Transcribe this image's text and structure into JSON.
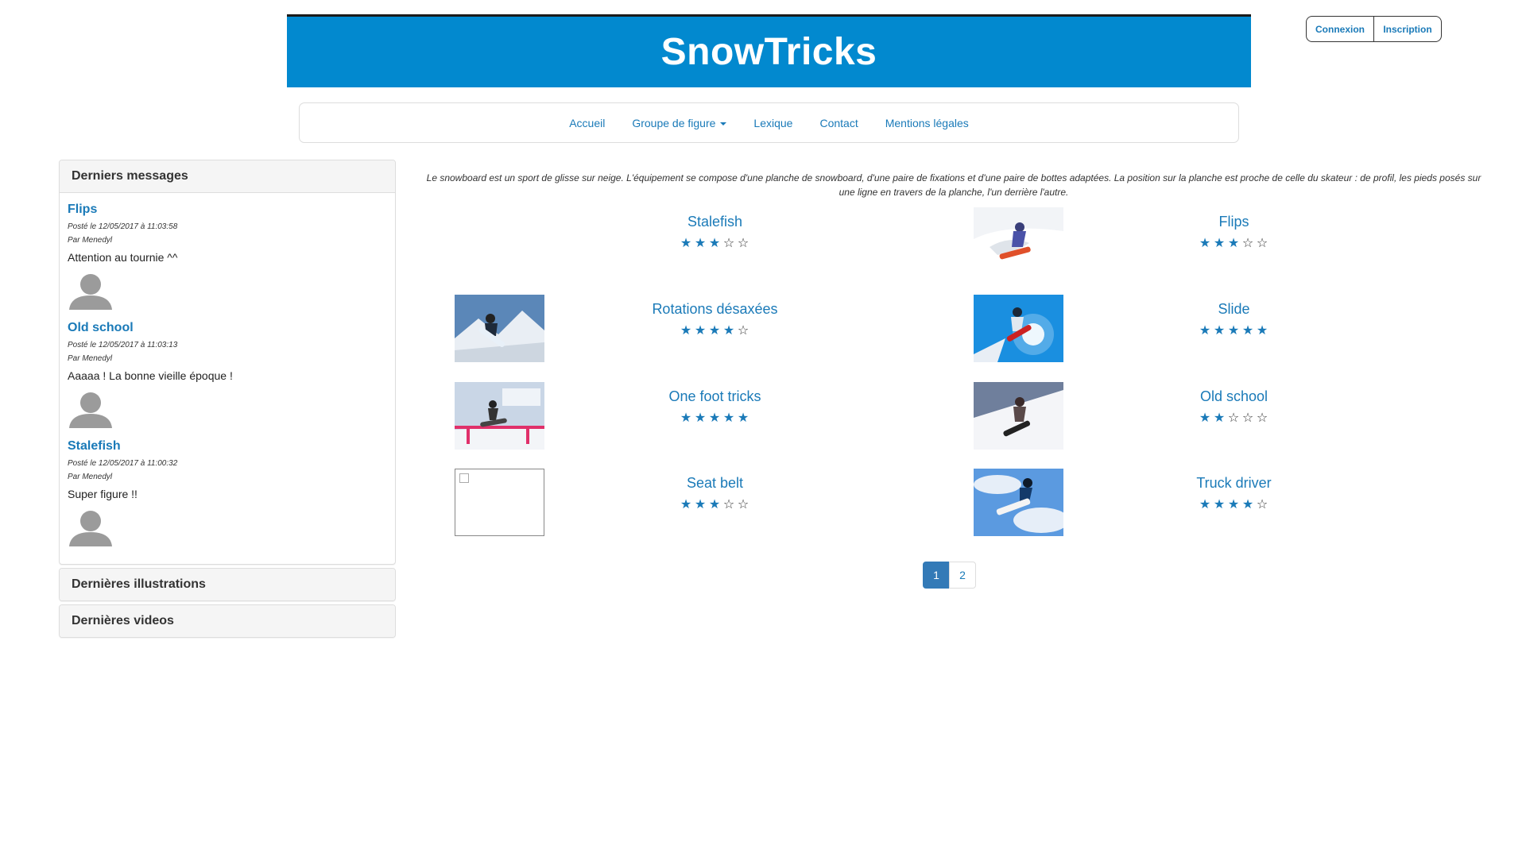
{
  "auth": {
    "login_label": "Connexion",
    "register_label": "Inscription"
  },
  "header": {
    "title": "SnowTricks"
  },
  "nav": {
    "items": [
      {
        "label": "Accueil"
      },
      {
        "label": "Groupe de figure"
      },
      {
        "label": "Lexique"
      },
      {
        "label": "Contact"
      },
      {
        "label": "Mentions légales"
      }
    ]
  },
  "sidebar": {
    "messages_title": "Derniers messages",
    "messages": [
      {
        "title": "Flips",
        "date": "Posté le 12/05/2017 à 11:03:58",
        "author": "Par Menedyl",
        "text": "Attention au tournie ^^"
      },
      {
        "title": "Old school",
        "date": "Posté le 12/05/2017 à 11:03:13",
        "author": "Par Menedyl",
        "text": "Aaaaa ! La bonne vieille époque !"
      },
      {
        "title": "Stalefish",
        "date": "Posté le 12/05/2017 à 11:00:32",
        "author": "Par Menedyl",
        "text": "Super figure !!"
      }
    ],
    "illustrations_title": "Dernières illustrations",
    "videos_title": "Dernières videos"
  },
  "intro": {
    "text": "Le snowboard est un sport de glisse sur neige. L'équipement se compose d'une planche de snowboard, d'une paire de fixations et d'une paire de bottes adaptées. La position sur la planche est proche de celle du skateur : de profil, les pieds posés sur une ligne en travers de la planche, l'un derrière l'autre."
  },
  "tricks": [
    {
      "name": "Stalefish",
      "rating": 3,
      "image": "none"
    },
    {
      "name": "Flips",
      "rating": 3,
      "image": "snowboarder-powder"
    },
    {
      "name": "Rotations désaxées",
      "rating": 4,
      "image": "snowboarder-jump-mountain"
    },
    {
      "name": "Slide",
      "rating": 5,
      "image": "snowboarder-sun-sky"
    },
    {
      "name": "One foot tricks",
      "rating": 5,
      "image": "snowboard-rail-ad"
    },
    {
      "name": "Old school",
      "rating": 2,
      "image": "snowboarder-slope"
    },
    {
      "name": "Seat belt",
      "rating": 3,
      "image": "broken-image"
    },
    {
      "name": "Truck driver",
      "rating": 4,
      "image": "snowboarder-air-sky"
    }
  ],
  "pagination": {
    "pages": [
      "1",
      "2"
    ],
    "current": "1"
  },
  "colors": {
    "brand": "#0289cf",
    "link": "#1a7ab8",
    "active_page": "#337ab7"
  }
}
